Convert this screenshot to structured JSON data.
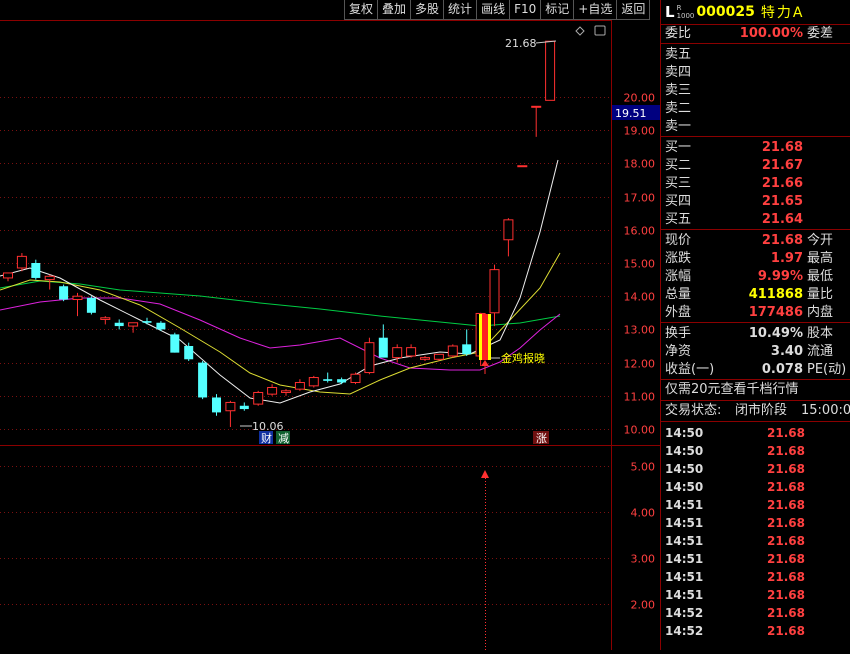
{
  "toolbar": {
    "items": [
      "复权",
      "叠加",
      "多股",
      "统计",
      "画线",
      "F10",
      "标记",
      "+自选",
      "返回"
    ]
  },
  "header": {
    "l": "L",
    "sup_top": "R",
    "sup_bottom": "1000",
    "code": "000025",
    "name": "特力A"
  },
  "weibi": {
    "label": "委比",
    "value": "100.00%",
    "label2": "委差"
  },
  "sell": [
    "卖五",
    "卖四",
    "卖三",
    "卖二",
    "卖一"
  ],
  "buy": [
    {
      "label": "买一",
      "price": "21.68"
    },
    {
      "label": "买二",
      "price": "21.67"
    },
    {
      "label": "买三",
      "price": "21.66"
    },
    {
      "label": "买四",
      "price": "21.65"
    },
    {
      "label": "买五",
      "price": "21.64"
    }
  ],
  "quote": [
    {
      "label": "现价",
      "value": "21.68",
      "label2": "今开",
      "color": "red"
    },
    {
      "label": "涨跌",
      "value": "1.97",
      "label2": "最高",
      "color": "red"
    },
    {
      "label": "涨幅",
      "value": "9.99%",
      "label2": "最低",
      "color": "red"
    },
    {
      "label": "总量",
      "value": "411868",
      "label2": "量比",
      "color": "yel"
    },
    {
      "label": "外盘",
      "value": "177486",
      "label2": "内盘",
      "color": "red"
    }
  ],
  "quote2": [
    {
      "label": "换手",
      "value": "10.49%",
      "label2": "股本",
      "color": "white"
    },
    {
      "label": "净资",
      "value": "3.40",
      "label2": "流通",
      "color": "white"
    },
    {
      "label": "收益(一)",
      "value": "0.078",
      "label2": "PE(动)",
      "color": "white"
    }
  ],
  "promo": "仅需20元查看千档行情",
  "status": {
    "label": "交易状态:",
    "value": "闭市阶段",
    "time": "15:00:0"
  },
  "ticks": [
    {
      "time": "14:50",
      "price": "21.68"
    },
    {
      "time": "14:50",
      "price": "21.68"
    },
    {
      "time": "14:50",
      "price": "21.68"
    },
    {
      "time": "14:50",
      "price": "21.68"
    },
    {
      "time": "14:51",
      "price": "21.68"
    },
    {
      "time": "14:51",
      "price": "21.68"
    },
    {
      "time": "14:51",
      "price": "21.68"
    },
    {
      "time": "14:51",
      "price": "21.68"
    },
    {
      "time": "14:51",
      "price": "21.68"
    },
    {
      "time": "14:51",
      "price": "21.68"
    },
    {
      "time": "14:52",
      "price": "21.68"
    },
    {
      "time": "14:52",
      "price": "21.68"
    }
  ],
  "chart_labels": {
    "current_price": "19.51",
    "high_annot": "21.68",
    "low_annot": "10.06",
    "signal": "金鸡报晓",
    "tag_cai": "财",
    "tag_jian": "减",
    "tag_zhang": "涨"
  },
  "chart_data": {
    "type": "candlestick",
    "yticks_price": [
      10.0,
      11.0,
      12.0,
      13.0,
      14.0,
      15.0,
      16.0,
      17.0,
      18.0,
      19.0,
      20.0
    ],
    "yticks_lower": [
      2.0,
      3.0,
      4.0,
      5.0
    ],
    "ylim_price": [
      9.8,
      22
    ],
    "candles": [
      {
        "o": 14.55,
        "h": 14.7,
        "l": 14.45,
        "c": 14.7
      },
      {
        "o": 14.85,
        "h": 15.3,
        "l": 14.75,
        "c": 15.2
      },
      {
        "o": 15.0,
        "h": 15.1,
        "l": 14.5,
        "c": 14.55
      },
      {
        "o": 14.5,
        "h": 14.65,
        "l": 14.2,
        "c": 14.6
      },
      {
        "o": 14.3,
        "h": 14.35,
        "l": 13.85,
        "c": 13.9
      },
      {
        "o": 13.9,
        "h": 14.1,
        "l": 13.4,
        "c": 14.0
      },
      {
        "o": 13.95,
        "h": 14.0,
        "l": 13.45,
        "c": 13.5
      },
      {
        "o": 13.3,
        "h": 13.4,
        "l": 13.15,
        "c": 13.35
      },
      {
        "o": 13.2,
        "h": 13.3,
        "l": 13.0,
        "c": 13.1
      },
      {
        "o": 13.1,
        "h": 13.2,
        "l": 12.9,
        "c": 13.2
      },
      {
        "o": 13.25,
        "h": 13.35,
        "l": 13.15,
        "c": 13.2
      },
      {
        "o": 13.2,
        "h": 13.25,
        "l": 12.95,
        "c": 13.0
      },
      {
        "o": 12.85,
        "h": 12.9,
        "l": 12.3,
        "c": 12.3
      },
      {
        "o": 12.5,
        "h": 12.6,
        "l": 12.05,
        "c": 12.1
      },
      {
        "o": 12.0,
        "h": 12.05,
        "l": 10.9,
        "c": 10.95
      },
      {
        "o": 10.95,
        "h": 11.05,
        "l": 10.4,
        "c": 10.5
      },
      {
        "o": 10.55,
        "h": 10.85,
        "l": 10.06,
        "c": 10.8
      },
      {
        "o": 10.7,
        "h": 10.8,
        "l": 10.55,
        "c": 10.6
      },
      {
        "o": 10.75,
        "h": 11.15,
        "l": 10.7,
        "c": 11.1
      },
      {
        "o": 11.05,
        "h": 11.35,
        "l": 11.0,
        "c": 11.25
      },
      {
        "o": 11.1,
        "h": 11.2,
        "l": 11.0,
        "c": 11.15
      },
      {
        "o": 11.2,
        "h": 11.5,
        "l": 11.15,
        "c": 11.4
      },
      {
        "o": 11.3,
        "h": 11.6,
        "l": 11.25,
        "c": 11.55
      },
      {
        "o": 11.5,
        "h": 11.7,
        "l": 11.4,
        "c": 11.45
      },
      {
        "o": 11.5,
        "h": 11.55,
        "l": 11.35,
        "c": 11.4
      },
      {
        "o": 11.4,
        "h": 11.7,
        "l": 11.35,
        "c": 11.65
      },
      {
        "o": 11.7,
        "h": 12.75,
        "l": 11.65,
        "c": 12.6
      },
      {
        "o": 12.75,
        "h": 13.15,
        "l": 12.2,
        "c": 12.15
      },
      {
        "o": 12.15,
        "h": 12.55,
        "l": 12.0,
        "c": 12.45
      },
      {
        "o": 12.2,
        "h": 12.55,
        "l": 12.15,
        "c": 12.45
      },
      {
        "o": 12.1,
        "h": 12.2,
        "l": 12.05,
        "c": 12.15
      },
      {
        "o": 12.1,
        "h": 12.25,
        "l": 12.05,
        "c": 12.25
      },
      {
        "o": 12.2,
        "h": 12.55,
        "l": 12.15,
        "c": 12.5
      },
      {
        "o": 12.55,
        "h": 13.0,
        "l": 12.2,
        "c": 12.25
      },
      {
        "o": 12.2,
        "h": 13.5,
        "l": 11.9,
        "c": 13.48
      },
      {
        "o": 13.5,
        "h": 14.95,
        "l": 13.1,
        "c": 14.8
      },
      {
        "o": 15.7,
        "h": 16.35,
        "l": 15.2,
        "c": 16.3
      },
      {
        "o": 17.93,
        "h": 17.93,
        "l": 17.93,
        "c": 17.93
      },
      {
        "o": 19.72,
        "h": 19.72,
        "l": 18.8,
        "c": 19.72
      },
      {
        "o": 19.9,
        "h": 21.68,
        "l": 19.9,
        "c": 21.68
      }
    ]
  }
}
